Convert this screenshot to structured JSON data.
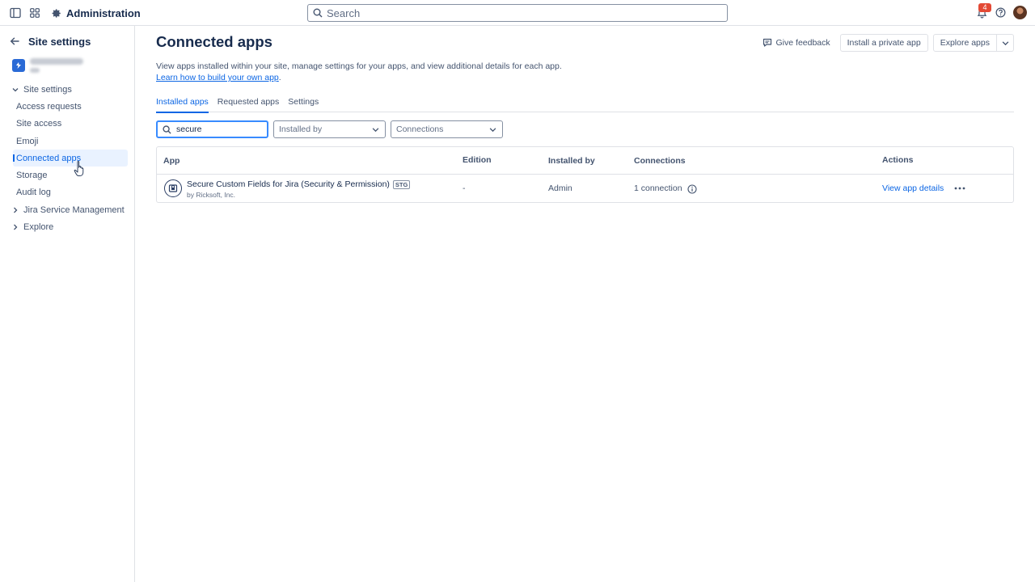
{
  "topbar": {
    "app_name": "Administration",
    "search_placeholder": "Search",
    "notification_count": "4"
  },
  "sidebar": {
    "title": "Site settings",
    "groups": [
      {
        "label": "Site settings",
        "expanded": true
      },
      {
        "label": "Jira Service Management",
        "expanded": false
      },
      {
        "label": "Explore",
        "expanded": false
      }
    ],
    "items": [
      {
        "label": "Access requests"
      },
      {
        "label": "Site access"
      },
      {
        "label": "Emoji"
      },
      {
        "label": "Connected apps",
        "active": true
      },
      {
        "label": "Storage"
      },
      {
        "label": "Audit log"
      }
    ]
  },
  "main": {
    "title": "Connected apps",
    "description": "View apps installed within your site, manage settings for your apps, and view additional details for each app.",
    "learn_link": "Learn how to build your own app",
    "learn_suffix": ".",
    "actions": {
      "feedback": "Give feedback",
      "install_private": "Install a private app",
      "explore": "Explore apps"
    },
    "tabs": [
      {
        "label": "Installed apps",
        "active": true
      },
      {
        "label": "Requested apps"
      },
      {
        "label": "Settings"
      }
    ],
    "filters": {
      "search_value": "secure",
      "installed_by_placeholder": "Installed by",
      "connections_placeholder": "Connections"
    },
    "table": {
      "columns": [
        "App",
        "Edition",
        "Installed by",
        "Connections",
        "Actions"
      ],
      "rows": [
        {
          "app_name": "Secure Custom Fields for Jira (Security & Permission)",
          "tag": "STG",
          "vendor": "by Ricksoft, Inc.",
          "edition": "-",
          "installed_by": "Admin",
          "connections": "1 connection",
          "action": "View app details"
        }
      ]
    }
  },
  "colors": {
    "accent": "#0c66e4",
    "badge": "#e34935",
    "text": "#172b4d",
    "subtle": "#44546f"
  }
}
